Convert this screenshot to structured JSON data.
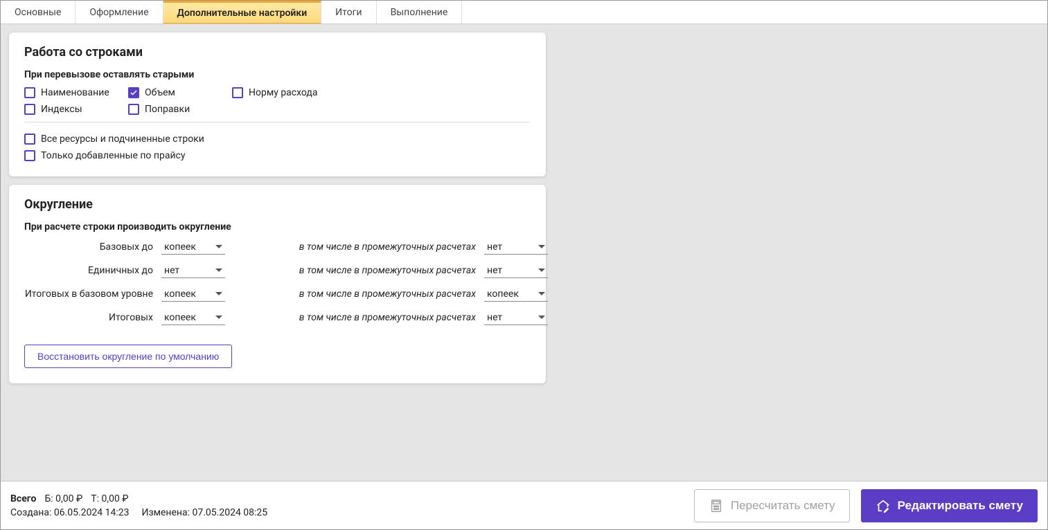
{
  "tabs": [
    {
      "label": "Основные"
    },
    {
      "label": "Оформление"
    },
    {
      "label": "Дополнительные настройки",
      "active": true
    },
    {
      "label": "Итоги"
    },
    {
      "label": "Выполнение"
    }
  ],
  "panel_rows": {
    "title": "Работа со строками",
    "subtitle": "При перевызове оставлять старыми",
    "checks": {
      "name": {
        "label": "Наименование",
        "checked": false
      },
      "volume": {
        "label": "Объем",
        "checked": true
      },
      "norm": {
        "label": "Норму расхода",
        "checked": false
      },
      "indexes": {
        "label": "Индексы",
        "checked": false
      },
      "corrections": {
        "label": "Поправки",
        "checked": false
      }
    },
    "extra_checks": {
      "all_resources": {
        "label": "Все ресурсы и подчиненные строки",
        "checked": false
      },
      "only_price": {
        "label": "Только добавленные по прайсу",
        "checked": false
      }
    }
  },
  "panel_rounding": {
    "title": "Округление",
    "subtitle": "При расчете строки производить округление",
    "midlabel": "в том числе в промежуточных расчетах",
    "rows": [
      {
        "label": "Базовых до",
        "v1": "копеек",
        "v2": "нет"
      },
      {
        "label": "Единичных до",
        "v1": "нет",
        "v2": "нет"
      },
      {
        "label": "Итоговых в базовом уровне",
        "v1": "копеек",
        "v2": "копеек"
      },
      {
        "label": "Итоговых",
        "v1": "копеек",
        "v2": "нет"
      }
    ],
    "restore_button": "Восстановить округление по умолчанию"
  },
  "footer": {
    "total_label": "Всего",
    "base_total": "Б: 0,00 ₽",
    "current_total": "Т: 0,00 ₽",
    "created_label": "Создана:",
    "created_value": "06.05.2024 14:23",
    "modified_label": "Изменена:",
    "modified_value": "07.05.2024 08:25",
    "recalc_button": "Пересчитать смету",
    "edit_button": "Редактировать смету"
  }
}
